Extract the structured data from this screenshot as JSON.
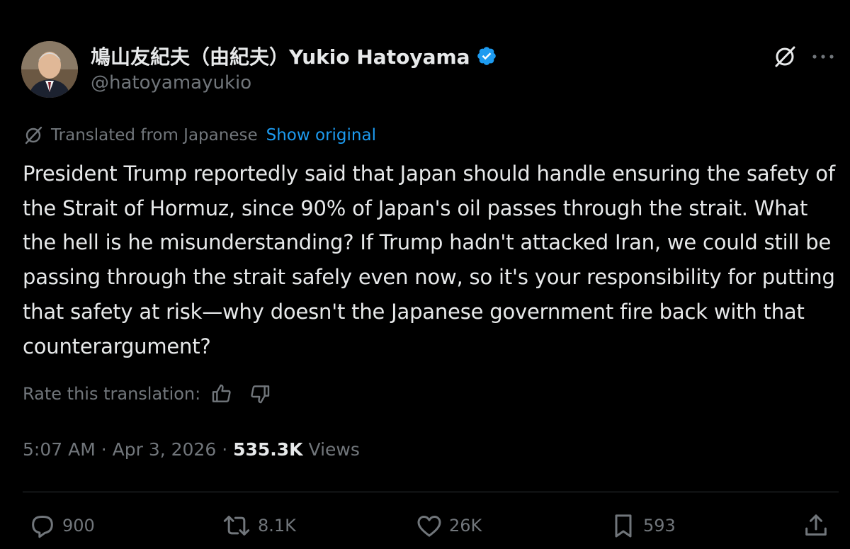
{
  "author": {
    "display_name": "鳩山友紀夫（由紀夫）Yukio Hatoyama",
    "handle": "@hatoyamayukio",
    "verified": true
  },
  "translation": {
    "note": "Translated from Japanese",
    "show_original_label": "Show original"
  },
  "tweet": {
    "text": "President Trump reportedly said that Japan should handle ensuring the safety of the Strait of Hormuz, since 90% of Japan's oil passes through the strait. What the hell is he misunderstanding? If Trump hadn't attacked Iran, we could still be passing through the strait safely even now, so it's your responsibility for putting that safety at risk—why doesn't the Japanese government fire back with that counterargument?"
  },
  "rating": {
    "label": "Rate this translation:"
  },
  "meta": {
    "time": "5:07 AM",
    "date": "Apr 3, 2026",
    "views_count": "535.3K",
    "views_label": "Views"
  },
  "actions": {
    "replies": "900",
    "reposts": "8.1K",
    "likes": "26K",
    "bookmarks": "593"
  },
  "colors": {
    "background": "#000000",
    "text": "#e7e9ea",
    "muted": "#71767b",
    "link": "#1d9bf0",
    "verified": "#1d9bf0",
    "divider": "#2f3336"
  },
  "icons": [
    "verified-badge-icon",
    "grok-icon",
    "more-icon",
    "translate-icon",
    "thumbs-up-icon",
    "thumbs-down-icon",
    "reply-icon",
    "repost-icon",
    "like-icon",
    "bookmark-icon",
    "share-icon"
  ]
}
